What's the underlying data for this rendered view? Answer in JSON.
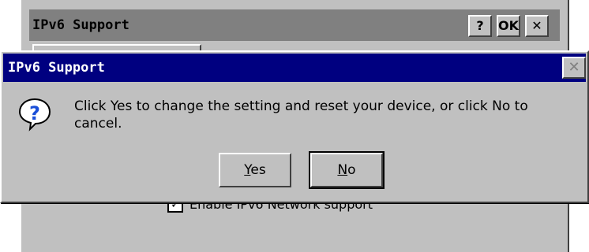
{
  "background_window": {
    "title": "IPv6 Support",
    "help_button": "?",
    "ok_button": "OK",
    "close_button": "✕",
    "checkbox": {
      "checked": true,
      "label": "Enable IPv6 Network support"
    }
  },
  "dialog": {
    "title": "IPv6 Support",
    "close_button": "✕",
    "icon": "question-icon",
    "message": "Click Yes to change the setting and reset your device, or click No to cancel.",
    "yes_button": {
      "mnemonic": "Y",
      "rest": "es"
    },
    "no_button": {
      "mnemonic": "N",
      "rest": "o"
    }
  },
  "colors": {
    "dialog_titlebar": "#000080",
    "background_titlebar": "#808080",
    "face": "#c0c0c0",
    "icon_blue": "#1a4fd8"
  }
}
